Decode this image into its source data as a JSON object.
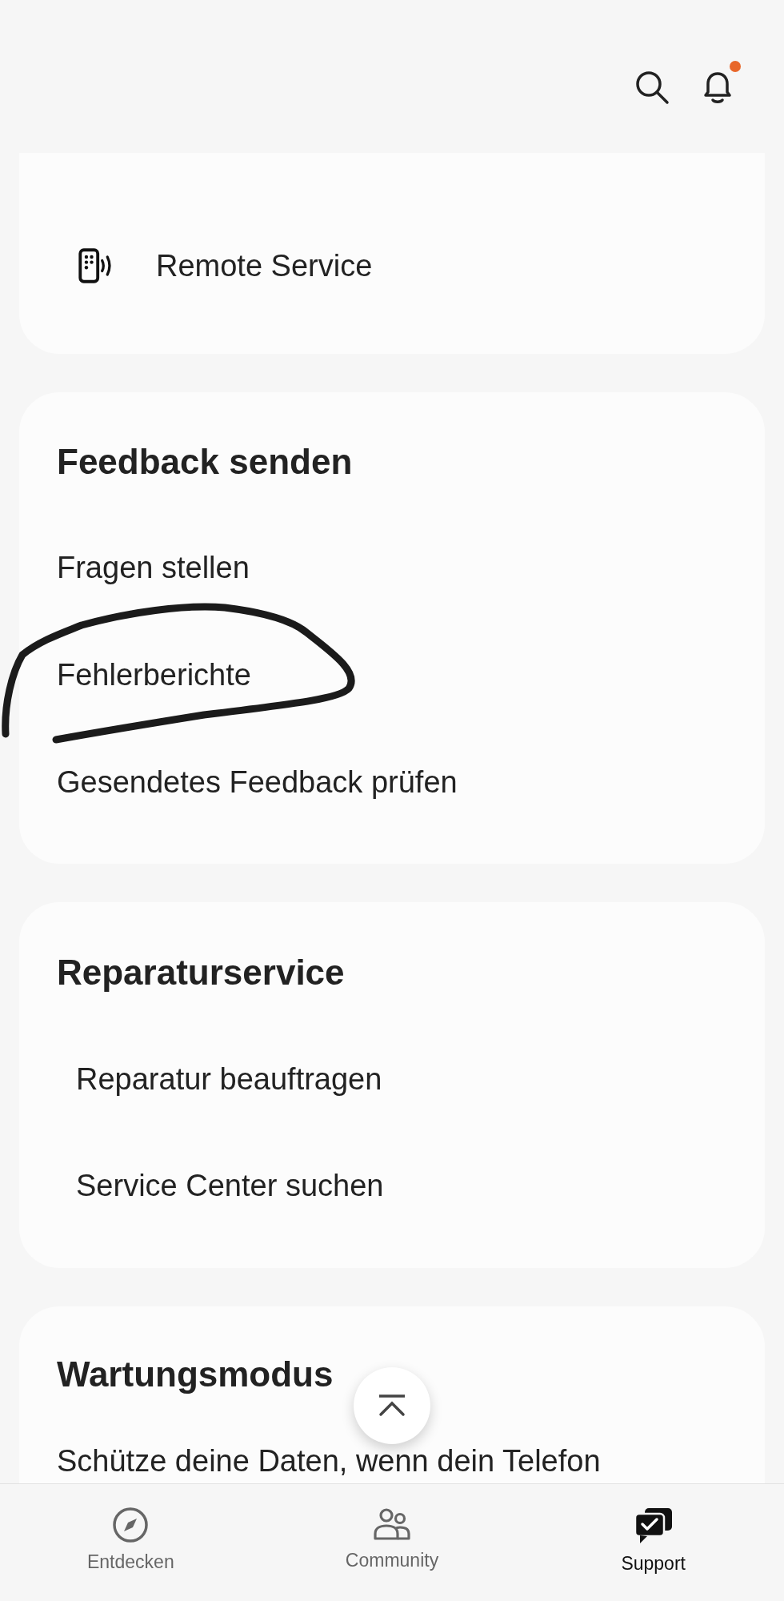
{
  "header": {
    "has_unread_notifications": true
  },
  "sections": [
    {
      "kind": "icon-list",
      "items": [
        "Remote Service"
      ]
    },
    {
      "kind": "links",
      "title": "Feedback senden",
      "items": [
        "Fragen stellen",
        "Fehlerberichte",
        "Gesendetes Feedback prüfen"
      ]
    },
    {
      "kind": "indented-links",
      "title": "Reparaturservice",
      "items": [
        "Reparatur beauftragen",
        "Service Center suchen"
      ]
    },
    {
      "kind": "text",
      "title": "Wartungsmodus",
      "text": "Schütze deine Daten, wenn dein Telefon"
    }
  ],
  "scroll_top_button": {
    "visible": true
  },
  "annotations": [
    {
      "kind": "loop"
    }
  ],
  "bottom_nav": [
    {
      "label": "Entdecken",
      "selected": false
    },
    {
      "label": "Community",
      "selected": false
    },
    {
      "label": "Support",
      "selected": true
    }
  ]
}
